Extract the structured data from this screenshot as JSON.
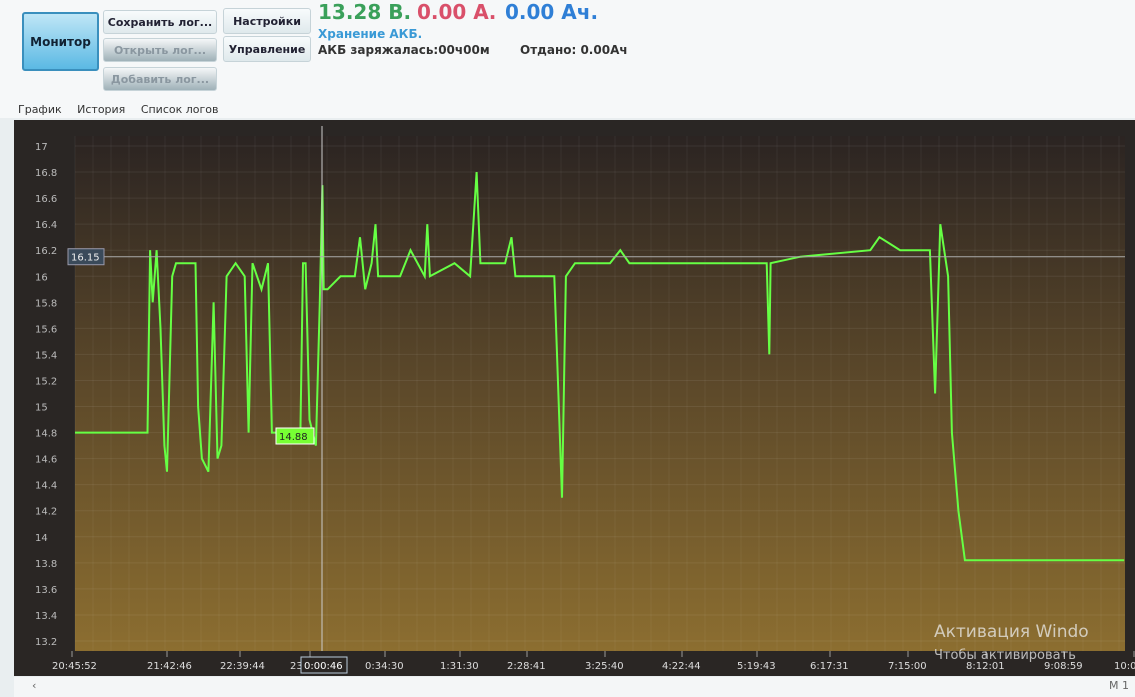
{
  "toolbar": {
    "monitor": "Монитор",
    "save_log": "Сохранить лог...",
    "open_log": "Открыть лог...",
    "add_log": "Добавить лог...",
    "settings": "Настройки",
    "control": "Управление"
  },
  "status": {
    "voltage": "13.28 В.",
    "current": "0.00 А.",
    "capacity": "0.00 Ач.",
    "mode": "Хранение АКБ.",
    "charged": "АКБ заряжалась:00ч00м",
    "given": "Отдано: 0.00Ач",
    "colors": {
      "voltage": "#3aa05a",
      "current": "#d9506a",
      "capacity": "#2f7fd6",
      "mode": "#3a9ad6"
    }
  },
  "tabs": [
    "График",
    "История",
    "Список логов"
  ],
  "watermark": {
    "line1": "Активация Windo",
    "line2": "Чтобы активировать"
  },
  "scroll": {
    "left": "‹",
    "right": "M 1"
  },
  "chart_data": {
    "type": "line",
    "ylim": [
      13.2,
      17
    ],
    "yticks": [
      "17",
      "16.8",
      "16.6",
      "16.4",
      "16.2",
      "16",
      "15.8",
      "15.6",
      "15.4",
      "15.2",
      "15",
      "14.8",
      "14.6",
      "14.4",
      "14.2",
      "14",
      "13.8",
      "13.6",
      "13.4",
      "13.2"
    ],
    "xticks": [
      "20:45:52",
      "21:42:46",
      "22:39:44",
      "23:37",
      "0:34:30",
      "1:31:30",
      "2:28:41",
      "3:25:40",
      "4:22:44",
      "5:19:43",
      "6:17:31",
      "7:15:00",
      "8:12:01",
      "9:08:59",
      "10:0"
    ],
    "grid": true,
    "line_color": "#66ff44",
    "cursor": {
      "time": "0:00:46",
      "value_label": "16.15",
      "marker_label": "14.88"
    },
    "points": [
      [
        "20:47",
        14.8
      ],
      [
        "21:43",
        14.8
      ],
      [
        "21:45",
        16.2
      ],
      [
        "21:47",
        15.8
      ],
      [
        "21:50",
        16.2
      ],
      [
        "21:53",
        15.6
      ],
      [
        "21:56",
        14.7
      ],
      [
        "21:58",
        14.5
      ],
      [
        "22:02",
        16.0
      ],
      [
        "22:05",
        16.1
      ],
      [
        "22:20",
        16.1
      ],
      [
        "22:22",
        15.0
      ],
      [
        "22:25",
        14.6
      ],
      [
        "22:30",
        14.5
      ],
      [
        "22:34",
        15.8
      ],
      [
        "22:37",
        14.6
      ],
      [
        "22:40",
        14.7
      ],
      [
        "22:44",
        16.0
      ],
      [
        "22:51",
        16.1
      ],
      [
        "22:58",
        16.0
      ],
      [
        "23:01",
        14.8
      ],
      [
        "23:04",
        16.1
      ],
      [
        "23:11",
        15.9
      ],
      [
        "23:16",
        16.1
      ],
      [
        "23:19",
        14.8
      ],
      [
        "23:41",
        14.8
      ],
      [
        "23:43",
        16.1
      ],
      [
        "23:45",
        16.1
      ],
      [
        "23:48",
        14.9
      ],
      [
        "23:53",
        14.7
      ],
      [
        "23:56",
        15.8
      ],
      [
        "23:58",
        16.7
      ],
      [
        "23:59",
        15.9
      ],
      [
        "0:02",
        15.9
      ],
      [
        "0:12",
        16.0
      ],
      [
        "0:23",
        16.0
      ],
      [
        "0:27",
        16.3
      ],
      [
        "0:31",
        15.9
      ],
      [
        "0:36",
        16.1
      ],
      [
        "0:39",
        16.4
      ],
      [
        "0:41",
        16.0
      ],
      [
        "0:58",
        16.0
      ],
      [
        "1:06",
        16.2
      ],
      [
        "1:17",
        16.0
      ],
      [
        "1:19",
        16.4
      ],
      [
        "1:21",
        16.0
      ],
      [
        "1:40",
        16.1
      ],
      [
        "1:52",
        16.0
      ],
      [
        "1:57",
        16.8
      ],
      [
        "2:00",
        16.1
      ],
      [
        "2:19",
        16.1
      ],
      [
        "2:24",
        16.3
      ],
      [
        "2:27",
        16.0
      ],
      [
        "2:57",
        16.0
      ],
      [
        "3:03",
        14.3
      ],
      [
        "3:06",
        16.0
      ],
      [
        "3:13",
        16.1
      ],
      [
        "3:40",
        16.1
      ],
      [
        "3:48",
        16.2
      ],
      [
        "3:55",
        16.1
      ],
      [
        "4:49",
        16.1
      ],
      [
        "5:41",
        16.1
      ],
      [
        "5:43",
        15.4
      ],
      [
        "5:44",
        16.1
      ],
      [
        "6:07",
        16.15
      ],
      [
        "7:01",
        16.2
      ],
      [
        "7:08",
        16.3
      ],
      [
        "7:24",
        16.2
      ],
      [
        "7:47",
        16.2
      ],
      [
        "7:51",
        15.1
      ],
      [
        "7:55",
        16.4
      ],
      [
        "8:01",
        16.0
      ],
      [
        "8:04",
        14.8
      ],
      [
        "8:09",
        14.2
      ],
      [
        "8:14",
        13.82
      ],
      [
        "10:17",
        13.82
      ]
    ]
  }
}
